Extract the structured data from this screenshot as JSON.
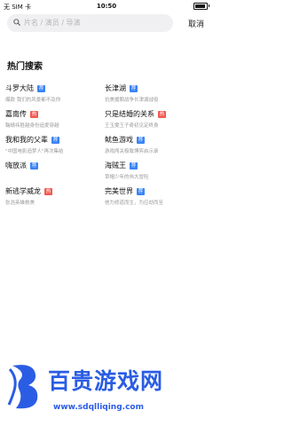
{
  "status_bar": {
    "carrier": "无 SIM 卡",
    "time": "10:50",
    "battery_level": 0.9
  },
  "search": {
    "placeholder": "片名 / 演员 / 导演",
    "cancel_label": "取消"
  },
  "section_title": "热门搜索",
  "hot_searches": [
    {
      "title": "斗罗大陆",
      "badge": "荐",
      "badge_type": "rec",
      "desc": "爆款 我们的风景都不及你"
    },
    {
      "title": "长津湖",
      "badge": "荐",
      "badge_type": "rec",
      "desc": "抗美援朝战争长津湖战役"
    },
    {
      "title": "嘉南传",
      "badge": "热",
      "badge_type": "hot",
      "desc": "鞠婧祎胜越身份追爱穿越"
    },
    {
      "title": "只是结婚的关系",
      "badge": "热",
      "badge_type": "hot",
      "desc": "王玉雯王子奇初见定终身"
    },
    {
      "title": "我和我的父辈",
      "badge": "荐",
      "badge_type": "rec",
      "desc": "\"中国电影追梦人\"再次集结"
    },
    {
      "title": "鱿鱼游戏",
      "badge": "荐",
      "badge_type": "rec",
      "desc": "游戏闯关极致博弈启示录"
    },
    {
      "title": "嗨放派",
      "badge": "荐",
      "badge_type": "rec",
      "desc": ""
    },
    {
      "title": "海贼王",
      "badge": "荐",
      "badge_type": "rec",
      "desc": "草帽少年的伟大冒险"
    },
    {
      "title": "新逃学威龙",
      "badge": "热",
      "badge_type": "hot",
      "desc": "张浩英雄救美"
    },
    {
      "title": "完美世界",
      "badge": "荐",
      "badge_type": "rec",
      "desc": "他为修道而生，为应劫而至"
    }
  ],
  "watermark": {
    "text": "百贵游戏网",
    "url": "www.sdqlliqing.com"
  },
  "colors": {
    "accent_blue": "#3a83f5",
    "hot_red": "#f15a52",
    "watermark_blue": "#2a5de4"
  }
}
